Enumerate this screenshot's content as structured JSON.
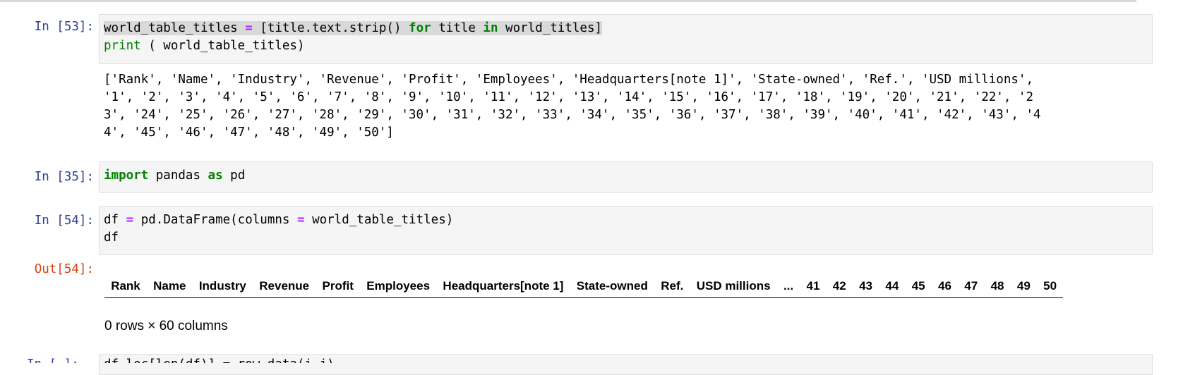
{
  "cells": [
    {
      "prompt": "In [53]:",
      "code": {
        "l1_a": "world_table_titles",
        "l1_op": "=",
        "l1_b": "[title.text.strip()",
        "l1_kw1": "for",
        "l1_c": "title",
        "l1_kw2": "in",
        "l1_d": "world_titles]",
        "l2_fn": "print",
        "l2_rest": " ( world_table_titles)"
      },
      "output": "['Rank', 'Name', 'Industry', 'Revenue', 'Profit', 'Employees', 'Headquarters[note 1]', 'State-owned', 'Ref.', 'USD millions',\n'1', '2', '3', '4', '5', '6', '7', '8', '9', '10', '11', '12', '13', '14', '15', '16', '17', '18', '19', '20', '21', '22', '2\n3', '24', '25', '26', '27', '28', '29', '30', '31', '32', '33', '34', '35', '36', '37', '38', '39', '40', '41', '42', '43', '4\n4', '45', '46', '47', '48', '49', '50']"
    },
    {
      "prompt": "In [35]:",
      "code": {
        "kw1": "import",
        "mod": "pandas",
        "kw2": "as",
        "alias": "pd"
      }
    },
    {
      "prompt": "In [54]:",
      "out_prompt": "Out[54]:",
      "code": {
        "l1_a": "df",
        "l1_op1": "=",
        "l1_b": "pd.DataFrame(columns",
        "l1_op2": "=",
        "l1_c": "world_table_titles)",
        "l2": "df"
      },
      "table_headers": [
        "Rank",
        "Name",
        "Industry",
        "Revenue",
        "Profit",
        "Employees",
        "Headquarters[note 1]",
        "State-owned",
        "Ref.",
        "USD millions",
        "...",
        "41",
        "42",
        "43",
        "44",
        "45",
        "46",
        "47",
        "48",
        "49",
        "50"
      ],
      "shape": "0 rows × 60 columns"
    },
    {
      "prompt": "In [ ]:",
      "code_partial": "df.loc[len(df)] = row_data(i,j)"
    }
  ],
  "colors": {
    "prompt_in": "#303f9f",
    "prompt_out": "#d84315",
    "keyword": "#008000",
    "operator": "#aa22ff",
    "cell_bg": "#f5f5f5"
  }
}
